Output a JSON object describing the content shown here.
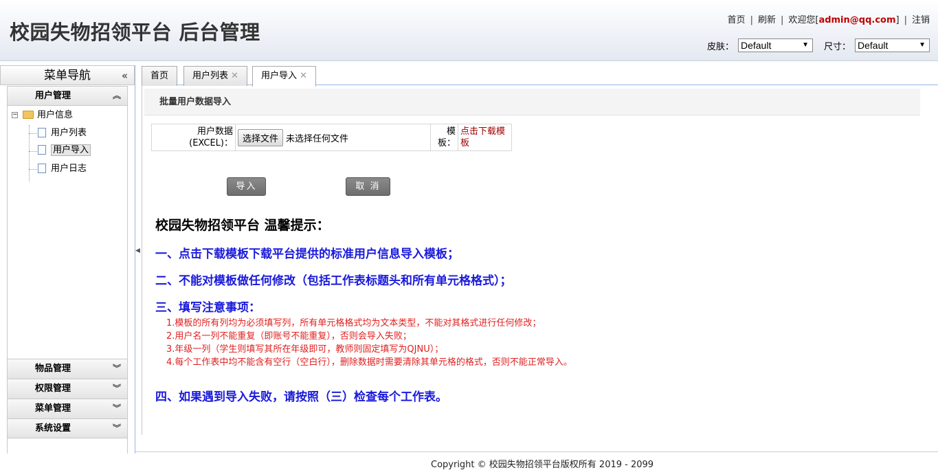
{
  "header": {
    "title": "校园失物招领平台 后台管理",
    "links": {
      "home": "首页",
      "refresh": "刷新",
      "welcome_prefix": "欢迎您[",
      "user": "admin@qq.com",
      "welcome_suffix": "]",
      "logout": "注销"
    },
    "skin_label": "皮肤：",
    "skin_value": "Default",
    "size_label": "尺寸：",
    "size_value": "Default"
  },
  "nav": {
    "title": "菜单导航",
    "panels": [
      {
        "label": "用户管理",
        "expanded": true
      },
      {
        "label": "物品管理",
        "expanded": false
      },
      {
        "label": "权限管理",
        "expanded": false
      },
      {
        "label": "菜单管理",
        "expanded": false
      },
      {
        "label": "系统设置",
        "expanded": false
      }
    ],
    "tree": {
      "root": "用户信息",
      "children": [
        "用户列表",
        "用户导入",
        "用户日志"
      ],
      "selected": "用户导入"
    }
  },
  "tabs": [
    {
      "label": "首页",
      "closable": false
    },
    {
      "label": "用户列表",
      "closable": true
    },
    {
      "label": "用户导入",
      "closable": true,
      "active": true
    }
  ],
  "import": {
    "section_title": "批量用户数据导入",
    "file_label_1": "用户数据",
    "file_label_2": "(EXCEL)：",
    "file_button": "选择文件",
    "file_status": "未选择任何文件",
    "template_label_1": "模",
    "template_label_2": "板：",
    "template_link_1": "点击下载模",
    "template_link_2": "板",
    "import_button": "导入",
    "cancel_button": "取 消"
  },
  "tips": {
    "title": "校园失物招领平台 温馨提示：",
    "item1": "一、点击下载模板下载平台提供的标准用户信息导入模板；",
    "item2": "二、不能对模板做任何修改（包括工作表标题头和所有单元格格式）；",
    "item3": "三、填写注意事项：",
    "sub": [
      "1.模板的所有列均为必须填写列，所有单元格格式均为文本类型，不能对其格式进行任何修改；",
      "2.用户名一列不能重复（即账号不能重复），否则会导入失败；",
      "3.年级一列（学生则填写其所在年级即可，教师则固定填写为QJNU）；",
      "4.每个工作表中均不能含有空行（空白行），删除数据时需要清除其单元格的格式，否则不能正常导入。"
    ],
    "item4": "四、如果遇到导入失败，请按照（三）检查每个工作表。"
  },
  "footer": "Copyright © 校园失物招领平台版权所有  2019 - 2099",
  "icons": [
    "collapse-left-icon",
    "expand-icon",
    "folder-open-icon",
    "document-icon",
    "close-icon",
    "dropdown-arrow-icon",
    "splitter-arrow-icon"
  ]
}
